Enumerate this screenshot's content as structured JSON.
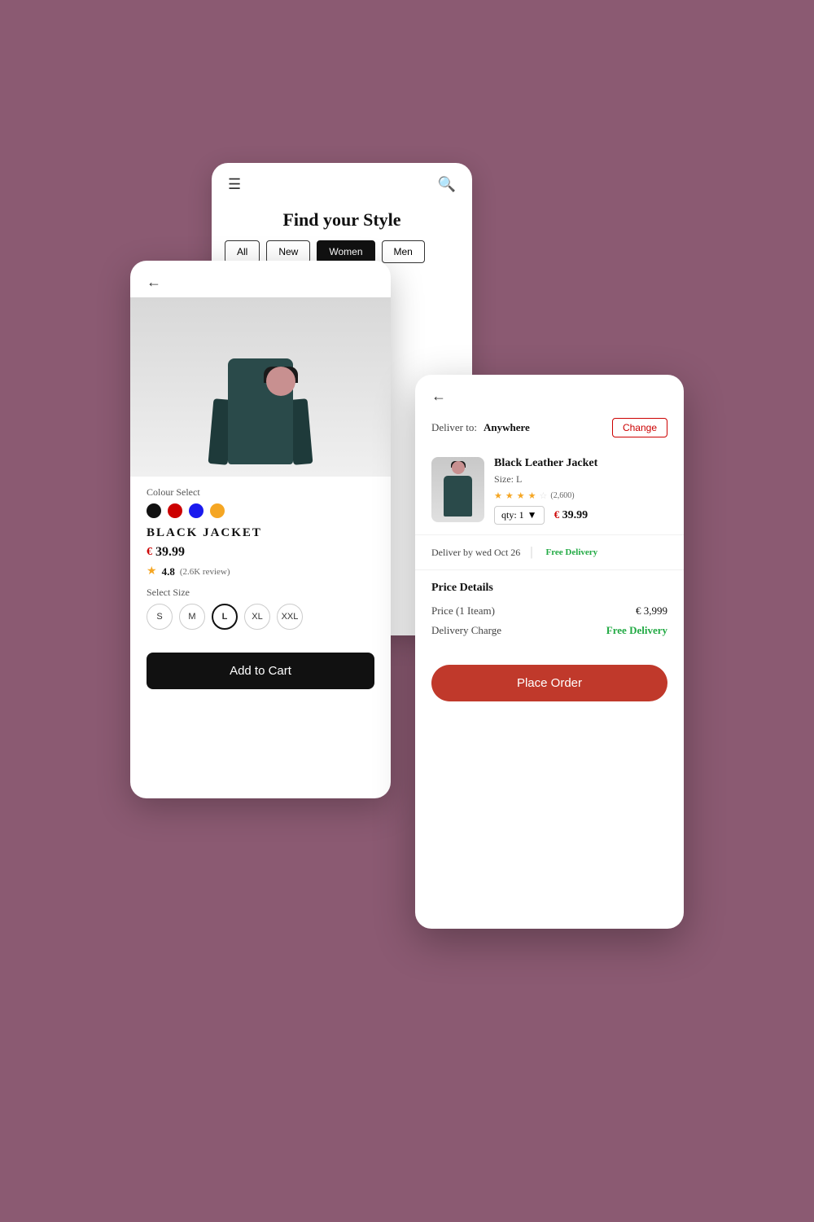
{
  "background_color": "#8B5A72",
  "screen1": {
    "title": "Find your Style",
    "nav": {
      "hamburger": "☰",
      "search": "🔍"
    },
    "categories": [
      {
        "label": "All",
        "active": false
      },
      {
        "label": "New",
        "active": false
      },
      {
        "label": "Women",
        "active": true
      },
      {
        "label": "Men",
        "active": false
      }
    ]
  },
  "screen2": {
    "back_arrow": "←",
    "colour_select_label": "Colour Select",
    "colours": [
      {
        "hex": "#111111"
      },
      {
        "hex": "#cc0000"
      },
      {
        "hex": "#1a1aee"
      },
      {
        "hex": "#F5A623"
      }
    ],
    "product_name": "BLACK JACKET",
    "currency_symbol": "€",
    "price": "39.99",
    "rating": "4.8",
    "review_count": "(2.6K review)",
    "select_size_label": "Select Size",
    "sizes": [
      {
        "label": "S",
        "selected": false
      },
      {
        "label": "M",
        "selected": false
      },
      {
        "label": "L",
        "selected": true
      },
      {
        "label": "XL",
        "selected": false
      },
      {
        "label": "XXL",
        "selected": false
      }
    ],
    "add_to_cart_label": "Add to Cart"
  },
  "screen3": {
    "back_arrow": "←",
    "deliver_to_label": "Deliver to:",
    "deliver_location": "Anywhere",
    "change_btn_label": "Change",
    "order_item": {
      "name": "Black Leather Jacket",
      "size": "Size: L",
      "rating_stars": 4,
      "rating_max": 5,
      "review_count": "(2,600)",
      "qty_label": "qty: 1",
      "currency": "€",
      "price": "39.99"
    },
    "delivery_by_label": "Deliver by wed Oct 26",
    "free_delivery_label": "Free Delivery",
    "price_details_title": "Price Details",
    "price_1item_label": "Price (1 Iteam)",
    "price_1item_value": "€ 3,999",
    "delivery_charge_label": "Delivery Charge",
    "delivery_charge_value": "Free Delivery",
    "place_order_label": "Place Order"
  }
}
